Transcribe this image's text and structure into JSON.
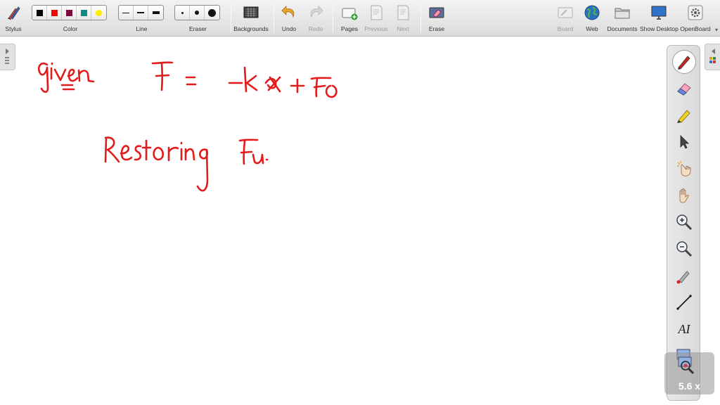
{
  "toolbar": {
    "stylus_label": "Stylus",
    "color_label": "Color",
    "line_label": "Line",
    "eraser_label": "Eraser",
    "backgrounds_label": "Backgrounds",
    "undo_label": "Undo",
    "redo_label": "Redo",
    "pages_label": "Pages",
    "previous_label": "Previous",
    "next_label": "Next",
    "erase_label": "Erase",
    "board_label": "Board",
    "web_label": "Web",
    "documents_label": "Documents",
    "show_desktop_label": "Show Desktop",
    "openboard_label": "OpenBoard",
    "colors": [
      "#000000",
      "#ff0000",
      "#7f0a3f",
      "#0e8a86",
      "#ffee00"
    ],
    "line_widths": [
      "thin",
      "medium",
      "thick"
    ],
    "eraser_sizes": [
      "small",
      "medium",
      "large"
    ]
  },
  "board": {
    "ink_color": "#e31b1b",
    "handwriting": {
      "line1": "given   F = -kx + F0",
      "line2": "Restoring Fu."
    }
  },
  "palette": {
    "tools": [
      "pen-icon",
      "eraser-icon",
      "highlighter-icon",
      "pointer-icon",
      "interact-icon",
      "hand-icon",
      "zoom-in-icon",
      "zoom-out-icon",
      "laser-pointer-icon",
      "line-icon",
      "text-icon",
      "capture-icon"
    ],
    "text_tool_label": "AI"
  },
  "zoom": {
    "value": "5.6 x"
  }
}
